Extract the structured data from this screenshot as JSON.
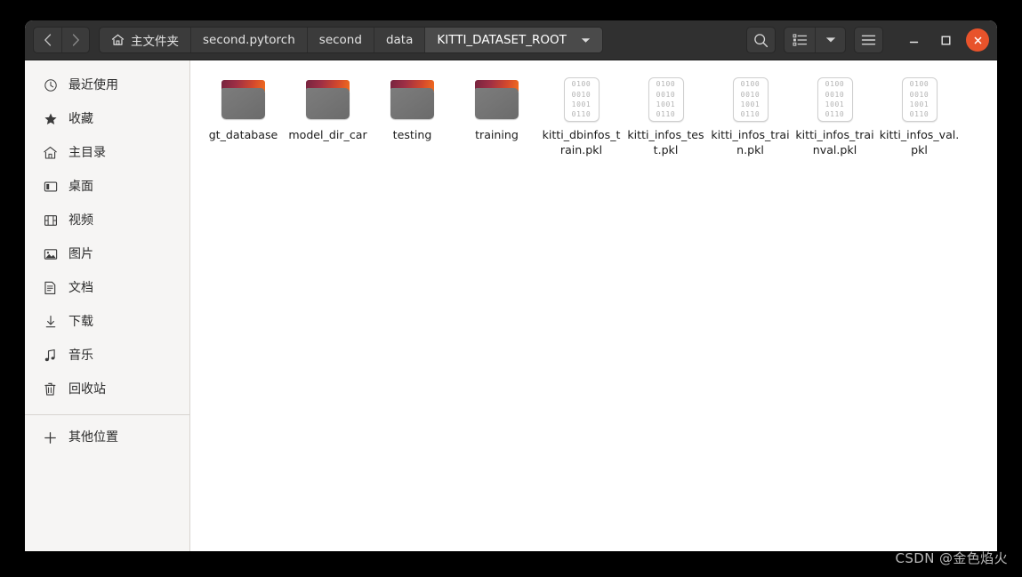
{
  "window": {
    "nav": {
      "back_label": "‹",
      "forward_label": "›"
    },
    "breadcrumb": [
      {
        "label": "主文件夹",
        "icon": "home-icon",
        "current": false
      },
      {
        "label": "second.pytorch",
        "icon": "",
        "current": false
      },
      {
        "label": "second",
        "icon": "",
        "current": false
      },
      {
        "label": "data",
        "icon": "",
        "current": false
      },
      {
        "label": "KITTI_DATASET_ROOT",
        "icon": "",
        "current": true
      }
    ],
    "toolbar": {
      "search_icon": "search-icon",
      "view_list_icon": "list-view-icon",
      "view_dropdown_icon": "chevron-down-icon",
      "menu_icon": "hamburger-menu-icon",
      "minimize_icon": "minimize-icon",
      "maximize_icon": "maximize-icon",
      "close_icon": "close-icon"
    },
    "controls": {
      "minimize_label": "—",
      "maximize_label": "☐",
      "close_label": "✕"
    }
  },
  "sidebar": {
    "items": [
      {
        "label": "最近使用",
        "icon": "clock-icon"
      },
      {
        "label": "收藏",
        "icon": "star-icon"
      },
      {
        "label": "主目录",
        "icon": "home-icon"
      },
      {
        "label": "桌面",
        "icon": "desktop-icon"
      },
      {
        "label": "视频",
        "icon": "video-icon"
      },
      {
        "label": "图片",
        "icon": "image-icon"
      },
      {
        "label": "文档",
        "icon": "document-icon"
      },
      {
        "label": "下载",
        "icon": "download-icon"
      },
      {
        "label": "音乐",
        "icon": "music-icon"
      },
      {
        "label": "回收站",
        "icon": "trash-icon"
      }
    ],
    "other_locations": {
      "label": "其他位置",
      "icon": "plus-icon"
    }
  },
  "files": {
    "binary_icon_rows": [
      "0100",
      "0010",
      "1001",
      "0110"
    ],
    "items": [
      {
        "name": "gt_database",
        "type": "folder"
      },
      {
        "name": "model_dir_car",
        "type": "folder"
      },
      {
        "name": "testing",
        "type": "folder"
      },
      {
        "name": "training",
        "type": "folder"
      },
      {
        "name": "kitti_dbinfos_train.pkl",
        "type": "binary"
      },
      {
        "name": "kitti_infos_test.pkl",
        "type": "binary"
      },
      {
        "name": "kitti_infos_train.pkl",
        "type": "binary"
      },
      {
        "name": "kitti_infos_trainval.pkl",
        "type": "binary"
      },
      {
        "name": "kitti_infos_val.pkl",
        "type": "binary"
      }
    ]
  },
  "watermark": {
    "text": "CSDN @金色焰火"
  },
  "colors": {
    "headerbar": "#303030",
    "sidebar": "#f6f5f4",
    "content": "#ffffff",
    "close_button": "#e8532b",
    "folder_accent": "#f06c1e",
    "desktop": "#000000"
  }
}
